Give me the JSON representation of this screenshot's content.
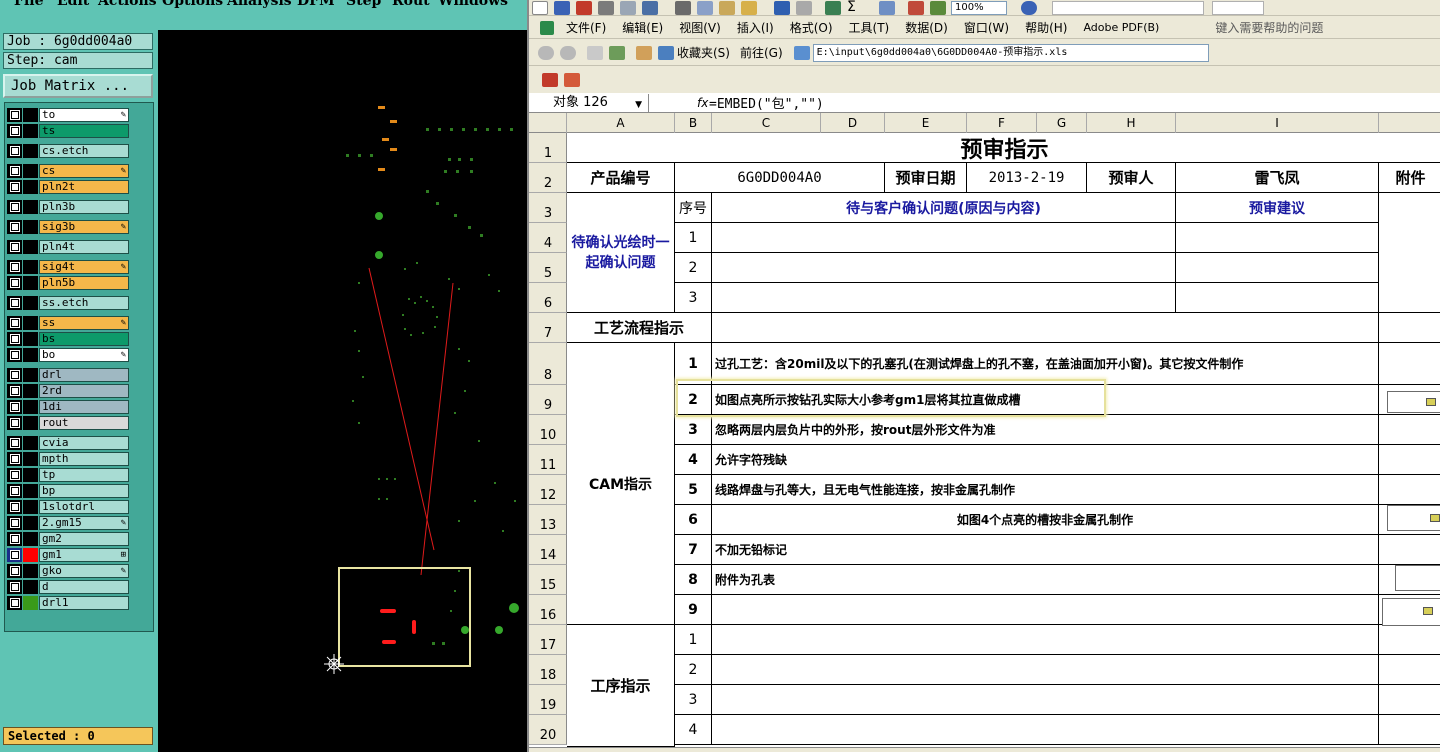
{
  "cam": {
    "menu": [
      "File",
      "Edit",
      "Actions",
      "Options",
      "Analysis",
      "DFM",
      "Step",
      "Rout",
      "Windows"
    ],
    "job_label": "Job : 6g0dd004a0",
    "step_label": "Step: cam",
    "matrix_button": "Job Matrix ...",
    "selected_label": "Selected : 0",
    "layers": [
      {
        "name": "to",
        "color": "#ffffff",
        "mark": "✎",
        "box": "#000000"
      },
      {
        "name": "ts",
        "color": "#0d9a6a",
        "mark": "",
        "box": "#000000"
      },
      {
        "name": "cs.etch",
        "color": "#a8dcd3",
        "mark": "",
        "box": "#000000"
      },
      {
        "name": "cs",
        "color": "#f5b74a",
        "mark": "✎",
        "box": "#000000"
      },
      {
        "name": "pln2t",
        "color": "#f5b74a",
        "mark": "",
        "box": "#000000"
      },
      {
        "name": "pln3b",
        "color": "#a8dcd3",
        "mark": "",
        "box": "#000000"
      },
      {
        "name": "sig3b",
        "color": "#f5b74a",
        "mark": "✎",
        "box": "#000000"
      },
      {
        "name": "pln4t",
        "color": "#a8dcd3",
        "mark": "",
        "box": "#000000"
      },
      {
        "name": "sig4t",
        "color": "#f5b74a",
        "mark": "✎",
        "box": "#000000"
      },
      {
        "name": "pln5b",
        "color": "#f5b74a",
        "mark": "",
        "box": "#000000"
      },
      {
        "name": "ss.etch",
        "color": "#a8dcd3",
        "mark": "",
        "box": "#000000"
      },
      {
        "name": "ss",
        "color": "#f5b74a",
        "mark": "✎",
        "box": "#000000"
      },
      {
        "name": "bs",
        "color": "#0d9a6a",
        "mark": "",
        "box": "#000000"
      },
      {
        "name": "bo",
        "color": "#ffffff",
        "mark": "✎",
        "box": "#000000"
      },
      {
        "name": "drl",
        "color": "#9fb8c2",
        "mark": "",
        "box": "#000000"
      },
      {
        "name": "2rd",
        "color": "#9fb8c2",
        "mark": "",
        "box": "#000000"
      },
      {
        "name": "1di",
        "color": "#9fb8c2",
        "mark": "",
        "box": "#000000"
      },
      {
        "name": "rout",
        "color": "#d9d9d9",
        "mark": "",
        "box": "#000000"
      },
      {
        "name": "cvia",
        "color": "#a8dcd3",
        "mark": "",
        "box": "#000000"
      },
      {
        "name": "mpth",
        "color": "#a8dcd3",
        "mark": "",
        "box": "#000000"
      },
      {
        "name": "tp",
        "color": "#a8dcd3",
        "mark": "",
        "box": "#000000"
      },
      {
        "name": "bp",
        "color": "#a8dcd3",
        "mark": "",
        "box": "#000000"
      },
      {
        "name": "1slotdrl",
        "color": "#a8dcd3",
        "mark": "",
        "box": "#000000"
      },
      {
        "name": "2.gm15",
        "color": "#a8dcd3",
        "mark": "✎",
        "box": "#000000"
      },
      {
        "name": "gm2",
        "color": "#a8dcd3",
        "mark": "",
        "box": "#000000"
      },
      {
        "name": "gm1",
        "color": "#a8dcd3",
        "mark": "⊞",
        "box": "#1a2f8a",
        "swatch": "#ff0000"
      },
      {
        "name": "gko",
        "color": "#a8dcd3",
        "mark": "✎",
        "box": "#000000"
      },
      {
        "name": "d",
        "color": "#a8dcd3",
        "mark": "",
        "box": "#000000"
      },
      {
        "name": "drl1",
        "color": "#a8dcd3",
        "mark": "",
        "box": "#000000",
        "swatch": "#3a9a1a"
      }
    ]
  },
  "excel": {
    "menu": [
      "文件(F)",
      "编辑(E)",
      "视图(V)",
      "插入(I)",
      "格式(O)",
      "工具(T)",
      "数据(D)",
      "窗口(W)",
      "帮助(H)",
      "Adobe PDF(B)"
    ],
    "help_placeholder": "键入需要帮助的问题",
    "zoom": "100%",
    "favorites": "收藏夹(S)",
    "goto": "前往(G)",
    "address": "E:\\input\\6g0dd004a0\\6G0DD004A0-预审指示.xls",
    "name_box": "对象 126",
    "fx": "fx",
    "formula": "=EMBED(\"包\",\"\")",
    "columns": [
      "A",
      "B",
      "C",
      "D",
      "E",
      "F",
      "G",
      "H",
      "I"
    ],
    "rows": [
      "1",
      "2",
      "3",
      "4",
      "5",
      "6",
      "7",
      "8",
      "9",
      "10",
      "11",
      "12",
      "13",
      "14",
      "15",
      "16",
      "17",
      "18",
      "19",
      "20"
    ],
    "title": "预审指示",
    "product_no_label": "产品编号",
    "product_no": "6G0DD004A0",
    "review_date_label": "预审日期",
    "review_date": "2013-2-19",
    "reviewer_label": "预审人",
    "reviewer": "雷飞凤",
    "attachment_label": "附件",
    "seq_label": "序号",
    "confirm_header": "待与客户确认问题(原因与内容)",
    "suggest_header": "预审建议",
    "pending_label": "待确认光绘时一起确认问题",
    "process_label": "工艺流程指示",
    "cam_label": "CAM指示",
    "procedure_label": "工序指示",
    "cam_items": [
      {
        "no": "1",
        "text": "过孔工艺：含20mil及以下的孔塞孔(在测试焊盘上的孔不塞，在盖油面加开小窗)。其它按文件制作"
      },
      {
        "no": "2",
        "text": "如图点亮所示按钻孔实际大小参考gm1层将其拉直做成槽"
      },
      {
        "no": "3",
        "text": "忽略两层内层负片中的外形，按rout层外形文件为准"
      },
      {
        "no": "4",
        "text": "允许字符残缺"
      },
      {
        "no": "5",
        "text": "线路焊盘与孔等大，且无电气性能连接，按非金属孔制作"
      },
      {
        "no": "6",
        "text": "如图4个点亮的槽按非金属孔制作"
      },
      {
        "no": "7",
        "text": "不加无铅标记"
      },
      {
        "no": "8",
        "text": "附件为孔表"
      },
      {
        "no": "9",
        "text": ""
      }
    ],
    "confirm_nos": [
      "1",
      "2",
      "3"
    ],
    "procedure_nos": [
      "1",
      "2",
      "3",
      "4"
    ],
    "colors": {
      "selection": "#e6e19c",
      "label_blue": "#1a1aa0"
    }
  }
}
